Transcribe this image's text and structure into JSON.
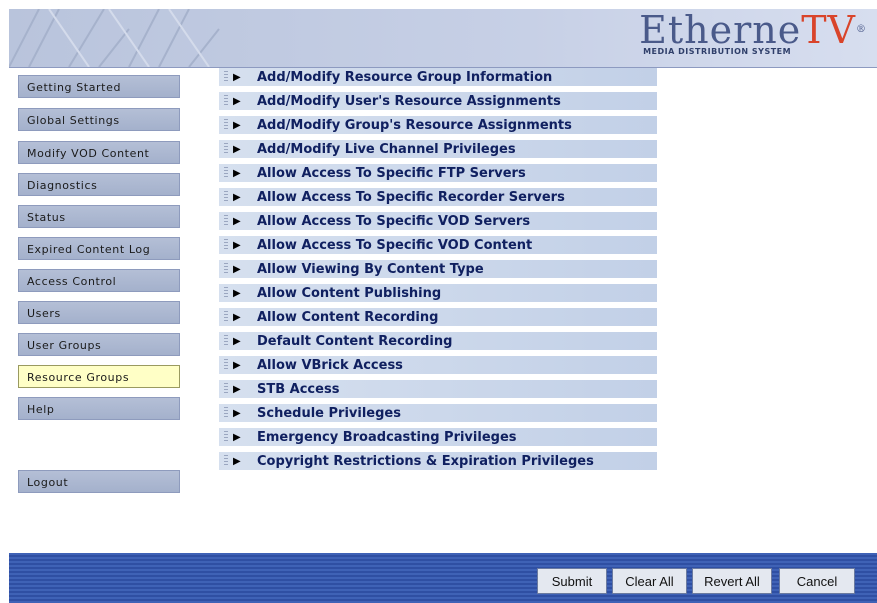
{
  "header": {
    "logo_main": "Etherne",
    "logo_accent": "TV",
    "logo_reg": "®",
    "logo_subtitle": "MEDIA DISTRIBUTION SYSTEM"
  },
  "nav": {
    "items": [
      {
        "label": "Getting Started"
      },
      {
        "label": "Global Settings"
      },
      {
        "label": "Modify VOD Content"
      },
      {
        "label": "Diagnostics"
      },
      {
        "label": "Status"
      },
      {
        "label": "Expired Content Log"
      },
      {
        "label": "Access Control"
      },
      {
        "label": "Users"
      },
      {
        "label": "User Groups"
      },
      {
        "label": "Resource Groups",
        "active": true
      },
      {
        "label": "Help"
      }
    ],
    "logout": "Logout"
  },
  "menu": {
    "items": [
      "Add/Modify Resource Group Information",
      "Add/Modify User's Resource Assignments",
      "Add/Modify Group's Resource Assignments",
      "Add/Modify Live Channel Privileges",
      "Allow Access To Specific FTP Servers",
      "Allow Access To Specific Recorder Servers",
      "Allow Access To Specific VOD Servers",
      "Allow Access To Specific VOD Content",
      "Allow Viewing By Content Type",
      "Allow Content Publishing",
      "Allow Content Recording",
      "Default Content Recording",
      "Allow VBrick Access",
      "STB Access",
      "Schedule Privileges",
      "Emergency Broadcasting Privileges",
      "Copyright Restrictions & Expiration Privileges"
    ]
  },
  "footer": {
    "submit": "Submit",
    "clear_all": "Clear All",
    "revert_all": "Revert All",
    "cancel": "Cancel"
  }
}
